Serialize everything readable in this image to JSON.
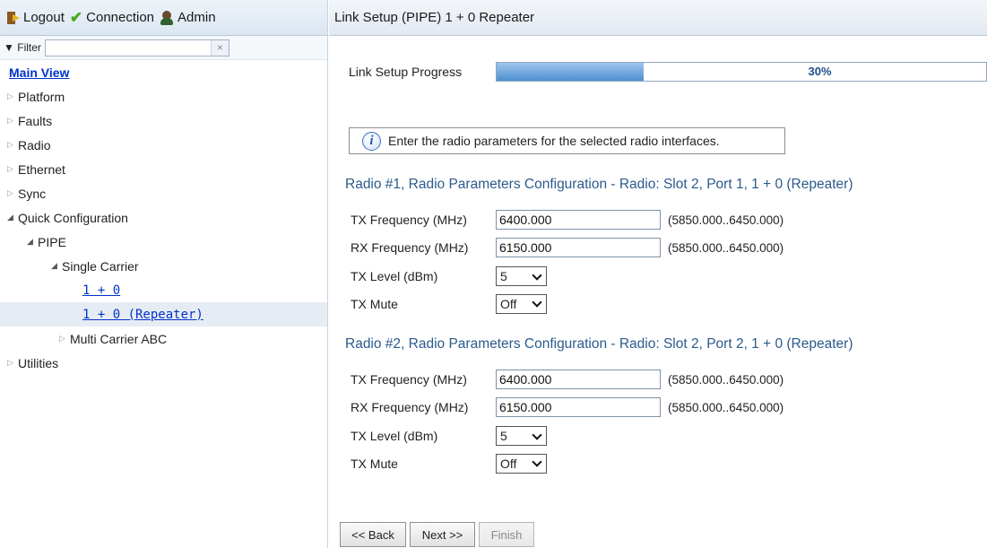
{
  "toolbar": {
    "logout_label": "Logout",
    "connection_label": "Connection",
    "admin_label": "Admin"
  },
  "filter": {
    "label": "Filter",
    "value": "",
    "placeholder": "",
    "clear_glyph": "×"
  },
  "nav": {
    "main_view": "Main View",
    "platform": "Platform",
    "faults": "Faults",
    "radio": "Radio",
    "ethernet": "Ethernet",
    "sync": "Sync",
    "quick_configuration": "Quick Configuration",
    "pipe": "PIPE",
    "single_carrier": "Single Carrier",
    "one_plus_zero": "1 + 0",
    "one_plus_zero_repeater": "1 + 0 (Repeater)",
    "multi_carrier_abc": "Multi Carrier ABC",
    "utilities": "Utilities",
    "selected_item": "1 + 0 (Repeater)"
  },
  "page": {
    "title": "Link Setup (PIPE) 1 + 0 Repeater",
    "progress_label": "Link Setup Progress",
    "progress_text": "30%",
    "progress_value": 0.3,
    "info_text": "Enter the radio parameters for the selected radio interfaces."
  },
  "radio1": {
    "title": "Radio #1, Radio Parameters Configuration - Radio: Slot 2, Port 1, 1 + 0 (Repeater)",
    "tx_freq_label": "TX Frequency (MHz)",
    "tx_freq_value": "6400.000",
    "tx_freq_range": "(5850.000..6450.000)",
    "rx_freq_label": "RX Frequency (MHz)",
    "rx_freq_value": "6150.000",
    "rx_freq_range": "(5850.000..6450.000)",
    "tx_level_label": "TX Level (dBm)",
    "tx_level_value": "5",
    "tx_mute_label": "TX Mute",
    "tx_mute_value": "Off"
  },
  "radio2": {
    "title": "Radio #2, Radio Parameters Configuration - Radio: Slot 2, Port 2, 1 + 0 (Repeater)",
    "tx_freq_label": "TX Frequency (MHz)",
    "tx_freq_value": "6400.000",
    "tx_freq_range": "(5850.000..6450.000)",
    "rx_freq_label": "RX Frequency (MHz)",
    "rx_freq_value": "6150.000",
    "rx_freq_range": "(5850.000..6450.000)",
    "tx_level_label": "TX Level (dBm)",
    "tx_level_value": "5",
    "tx_mute_label": "TX Mute",
    "tx_mute_value": "Off"
  },
  "buttons": {
    "back": "<< Back",
    "next": "Next >>",
    "finish": "Finish"
  },
  "colors": {
    "section_title": "#2b5a8c",
    "link": "#0033cc",
    "progress_fill": "#4f8fd1",
    "selected_row": "#e6ecf3"
  }
}
